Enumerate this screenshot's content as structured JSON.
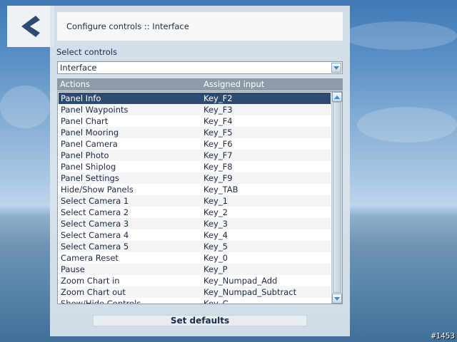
{
  "header": {
    "title": "Configure controls :: Interface"
  },
  "select": {
    "label": "Select controls",
    "value": "Interface"
  },
  "table": {
    "columns": [
      "Actions",
      "Assigned input"
    ],
    "rows": [
      {
        "action": "Panel Info",
        "input": "Key_F2",
        "selected": true
      },
      {
        "action": "Panel Waypoints",
        "input": "Key_F3"
      },
      {
        "action": "Panel Chart",
        "input": "Key_F4"
      },
      {
        "action": "Panel Mooring",
        "input": "Key_F5"
      },
      {
        "action": "Panel Camera",
        "input": "Key_F6"
      },
      {
        "action": "Panel Photo",
        "input": "Key_F7"
      },
      {
        "action": "Panel Shiplog",
        "input": "Key_F8"
      },
      {
        "action": "Panel Settings",
        "input": "Key_F9"
      },
      {
        "action": "Hide/Show Panels",
        "input": "Key_TAB"
      },
      {
        "action": "Select Camera 1",
        "input": "Key_1"
      },
      {
        "action": "Select Camera 2",
        "input": "Key_2"
      },
      {
        "action": "Select Camera 3",
        "input": "Key_3"
      },
      {
        "action": "Select Camera 4",
        "input": "Key_4"
      },
      {
        "action": "Select Camera 5",
        "input": "Key_5"
      },
      {
        "action": "Camera Reset",
        "input": "Key_0"
      },
      {
        "action": "Pause",
        "input": "Key_P"
      },
      {
        "action": "Zoom Chart in",
        "input": "Key_Numpad_Add"
      },
      {
        "action": "Zoom Chart out",
        "input": "Key_Numpad_Subtract"
      },
      {
        "action": "Show/Hide Controls",
        "input": "Key_C"
      }
    ]
  },
  "buttons": {
    "defaults_label": "Set defaults"
  },
  "overlay": {
    "frame_counter": "#1453"
  },
  "colors": {
    "selected_row": "#2d4a70",
    "header_bg": "#8d9aa7",
    "back_arrow": "#2d4a70",
    "scroll_arrow": "#3a8ec9"
  }
}
